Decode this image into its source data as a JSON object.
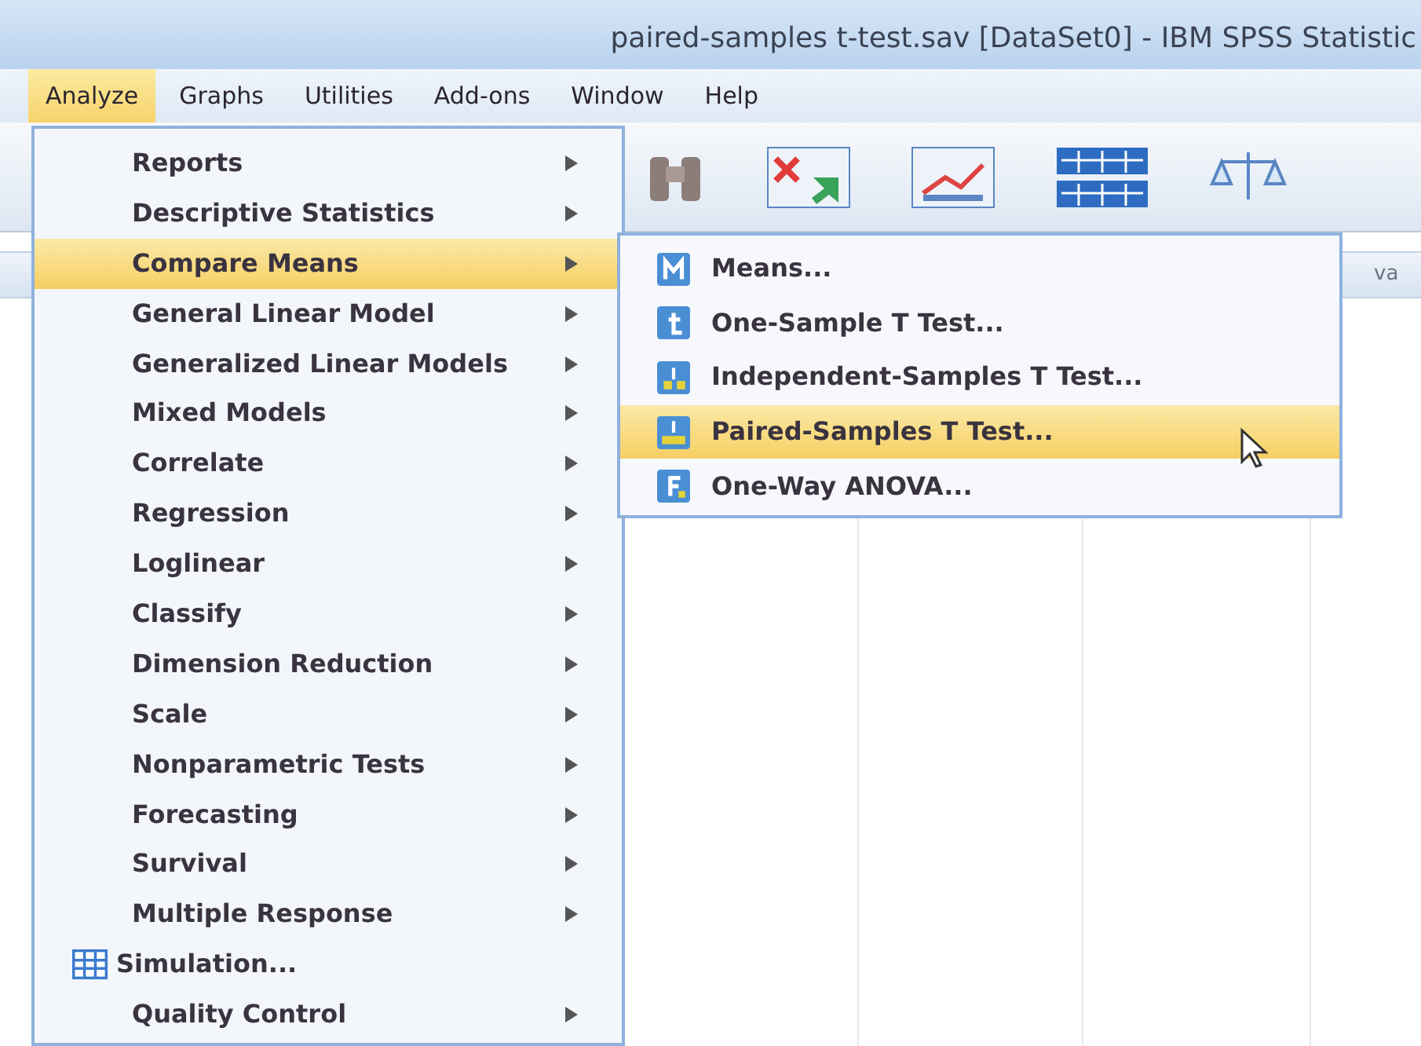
{
  "window": {
    "title": "paired-samples t-test.sav [DataSet0] - IBM SPSS Statistic"
  },
  "menu_bar": [
    {
      "label": "Analyze",
      "selected": true
    },
    {
      "label": "Graphs",
      "selected": false
    },
    {
      "label": "Utilities",
      "selected": false
    },
    {
      "label": "Add-ons",
      "selected": false
    },
    {
      "label": "Window",
      "selected": false
    },
    {
      "label": "Help",
      "selected": false
    }
  ],
  "analyze_menu": [
    {
      "label": "Reports",
      "kind": "submenu",
      "selected": false
    },
    {
      "label": "Descriptive Statistics",
      "kind": "submenu",
      "selected": false
    },
    {
      "label": "Compare Means",
      "kind": "submenu",
      "selected": true
    },
    {
      "label": "General Linear Model",
      "kind": "submenu",
      "selected": false
    },
    {
      "label": "Generalized Linear Models",
      "kind": "submenu",
      "selected": false
    },
    {
      "label": "Mixed Models",
      "kind": "submenu",
      "selected": false
    },
    {
      "label": "Correlate",
      "kind": "submenu",
      "selected": false
    },
    {
      "label": "Regression",
      "kind": "submenu",
      "selected": false
    },
    {
      "label": "Loglinear",
      "kind": "submenu",
      "selected": false
    },
    {
      "label": "Classify",
      "kind": "submenu",
      "selected": false
    },
    {
      "label": "Dimension Reduction",
      "kind": "submenu",
      "selected": false
    },
    {
      "label": "Scale",
      "kind": "submenu",
      "selected": false
    },
    {
      "label": "Nonparametric Tests",
      "kind": "submenu",
      "selected": false
    },
    {
      "label": "Forecasting",
      "kind": "submenu",
      "selected": false
    },
    {
      "label": "Survival",
      "kind": "submenu",
      "selected": false
    },
    {
      "label": "Multiple Response",
      "kind": "submenu",
      "selected": false
    },
    {
      "label": "Simulation...",
      "kind": "command",
      "selected": false
    },
    {
      "label": "Quality Control",
      "kind": "submenu",
      "selected": false
    }
  ],
  "compare_means_submenu": [
    {
      "label": "Means...",
      "selected": false
    },
    {
      "label": "One-Sample T Test...",
      "selected": false
    },
    {
      "label": "Independent-Samples T Test...",
      "selected": false
    },
    {
      "label": "Paired-Samples T Test...",
      "selected": true
    },
    {
      "label": "One-Way ANOVA...",
      "selected": false
    }
  ],
  "data_grid": {
    "column_header": "va"
  }
}
